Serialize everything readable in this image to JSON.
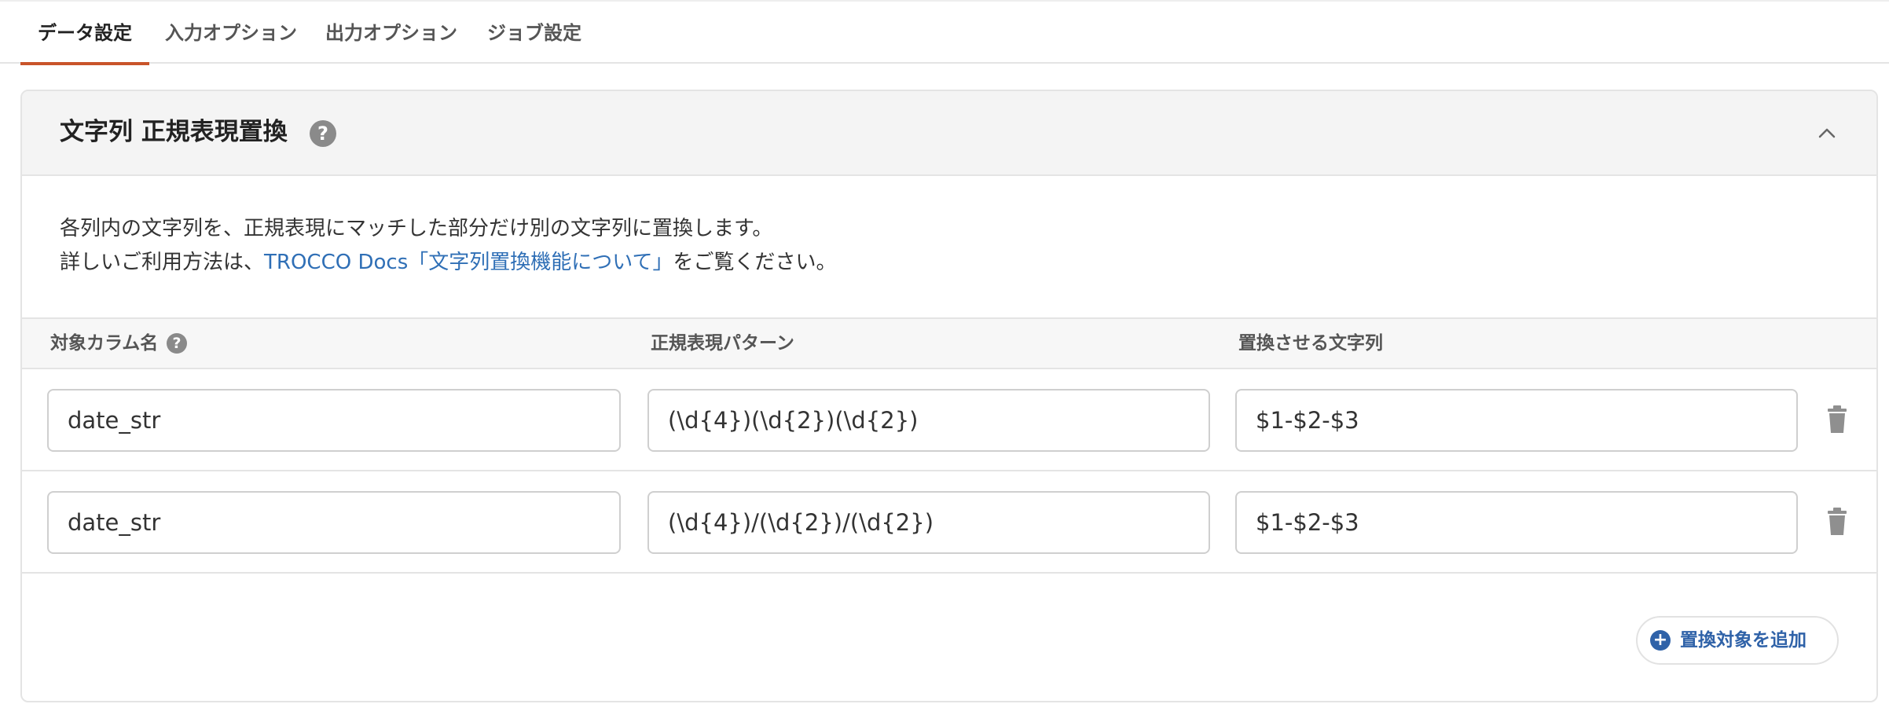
{
  "tabs": [
    {
      "label": "データ設定",
      "active": true
    },
    {
      "label": "入力オプション",
      "active": false
    },
    {
      "label": "出力オプション",
      "active": false
    },
    {
      "label": "ジョブ設定",
      "active": false
    }
  ],
  "panel": {
    "title": "文字列 正規表現置換",
    "help_glyph": "?",
    "desc_line1": "各列内の文字列を、正規表現にマッチした部分だけ別の文字列に置換します。",
    "desc_line2_prefix": "詳しいご利用方法は、",
    "desc_link": "TROCCO Docs「文字列置換機能について」",
    "desc_line2_suffix": "をご覧ください。"
  },
  "table": {
    "headers": {
      "column_name": "対象カラム名",
      "pattern": "正規表現パターン",
      "replacement": "置換させる文字列"
    },
    "rows": [
      {
        "column_name": "date_str",
        "pattern": "(\\d{4})(\\d{2})(\\d{2})",
        "replacement": "$1-$2-$3"
      },
      {
        "column_name": "date_str",
        "pattern": "(\\d{4})/(\\d{2})/(\\d{2})",
        "replacement": "$1-$2-$3"
      }
    ]
  },
  "add_button": {
    "plus": "+",
    "label": "置換対象を追加"
  },
  "colors": {
    "accent": "#c9542a",
    "link": "#2f6fb6",
    "button": "#2f62a8"
  },
  "icons": {
    "help": "question-circle-icon",
    "collapse": "chevron-up-icon",
    "delete": "trash-icon",
    "add": "plus-circle-icon"
  }
}
